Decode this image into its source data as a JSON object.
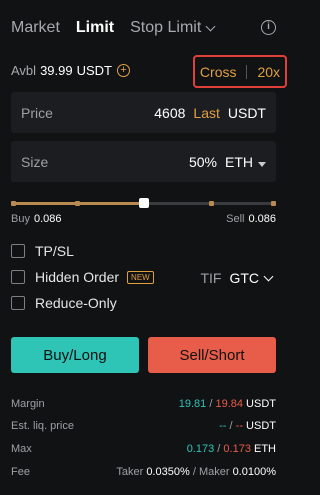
{
  "tabs": {
    "market": "Market",
    "limit": "Limit",
    "stop_limit": "Stop Limit"
  },
  "avbl": {
    "label": "Avbl",
    "value": "39.99",
    "unit": "USDT"
  },
  "margin_mode": {
    "mode": "Cross",
    "leverage": "20x"
  },
  "price": {
    "label": "Price",
    "value": "4608",
    "last": "Last",
    "unit": "USDT"
  },
  "size": {
    "label": "Size",
    "value": "50%",
    "unit": "ETH"
  },
  "slider": {
    "level_percent": 50
  },
  "buy_sell": {
    "buy_label": "Buy",
    "buy_value": "0.086",
    "sell_label": "Sell",
    "sell_value": "0.086"
  },
  "options": {
    "tp_sl": "TP/SL",
    "hidden_order": "Hidden Order",
    "new_badge": "NEW",
    "reduce_only": "Reduce-Only",
    "tif_label": "TIF",
    "tif_value": "GTC"
  },
  "actions": {
    "buy": "Buy/Long",
    "sell": "Sell/Short"
  },
  "info": {
    "margin": {
      "label": "Margin",
      "buy": "19.81",
      "sell": "19.84",
      "unit": "USDT",
      "sep": "/"
    },
    "liq": {
      "label": "Est. liq. price",
      "buy": "--",
      "sell": "--",
      "unit": "USDT",
      "sep": "/"
    },
    "max": {
      "label": "Max",
      "buy": "0.173",
      "sell": "0.173",
      "unit": "ETH",
      "sep": "/"
    },
    "fee": {
      "label": "Fee",
      "taker_label": "Taker",
      "taker": "0.0350%",
      "maker_label": "Maker",
      "maker": "0.0100%",
      "sep": "/"
    }
  },
  "colors": {
    "accent": "#e0a040",
    "buy": "#2ec4b6",
    "sell": "#e85d4a",
    "highlight_border": "#e0403a"
  }
}
